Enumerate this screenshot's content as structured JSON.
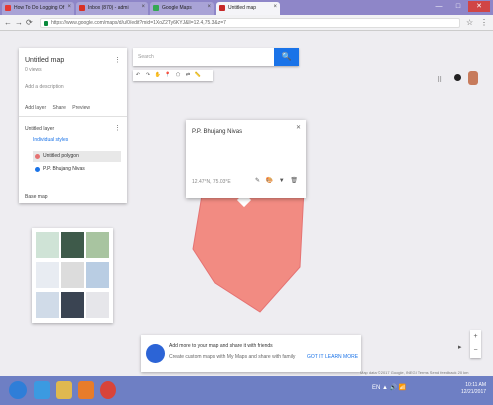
{
  "browser": {
    "tabs": [
      {
        "label": "How To Do Logging Of",
        "favicon_color": "#e53935",
        "active": false
      },
      {
        "label": "Inbox (870) - admi",
        "favicon_color": "#d93025",
        "active": false
      },
      {
        "label": "Google Maps",
        "favicon_color": "#34a853",
        "active": false
      },
      {
        "label": "Untitled map",
        "favicon_color": "#c62828",
        "active": true
      }
    ],
    "window_controls": {
      "minimize": "—",
      "maximize": "□",
      "close": "✕"
    },
    "url": "https://www.google.com/maps/d/u/0/edit?mid=1XoZ2Ty6KYJ&ll=12.4,75.3&z=7",
    "nav": {
      "back": "←",
      "forward": "→",
      "reload": "⟳",
      "star": "☆",
      "menu": "⋮"
    }
  },
  "map_panel": {
    "title": "Untitled map",
    "subtitle": "0 views",
    "description": "Add a description",
    "actions": [
      "Add layer",
      "Share",
      "Preview"
    ],
    "menu_glyph": "⋮",
    "layer_name": "Untitled layer",
    "layer_style": "Individual styles",
    "features": [
      {
        "label": "Untitled polygon",
        "color": "#e57373",
        "selected": true
      },
      {
        "label": "P.P. Bhujang Nivas",
        "color": "#1a73e8",
        "selected": false
      }
    ],
    "basemap_label": "Base map"
  },
  "basemap_thumbs": [
    {
      "name": "map",
      "color": "#cfe3d6"
    },
    {
      "name": "satellite",
      "color": "#3e5a4a"
    },
    {
      "name": "terrain",
      "color": "#a8c4a0"
    },
    {
      "name": "light-political",
      "color": "#e8ecf2"
    },
    {
      "name": "mono-city",
      "color": "#dcdcdc"
    },
    {
      "name": "simple-atlas",
      "color": "#b9cde3"
    },
    {
      "name": "light-landmass",
      "color": "#d0dbe8"
    },
    {
      "name": "dark-landmass",
      "color": "#3a4452"
    },
    {
      "name": "whitewater",
      "color": "#e6e6ea"
    }
  ],
  "search": {
    "placeholder": "Search",
    "button_icon": "🔍"
  },
  "tools": [
    "↶",
    "↷",
    "✋",
    "📍",
    "⬠",
    "⇄",
    "📏"
  ],
  "popup": {
    "title": "P.P. Bhujang Nivas",
    "close": "✕",
    "info": "12.47°N, 75.03°E",
    "icons": "✎ 🎨 ▼ 🗑"
  },
  "polygon": {
    "fill": "#f28b82",
    "stroke": "#e57373"
  },
  "marker": {
    "color": "#1a73e8"
  },
  "notice": {
    "title": "Add more to your map and share it with friends",
    "body": "Create custom maps with My Maps and share with family",
    "dismiss": "GOT IT",
    "learn_more": "LEARN MORE"
  },
  "zoom": {
    "plus": "+",
    "minus": "−"
  },
  "footer": "Map data ©2017 Google, INEGI  Terms  Send feedback  20 km",
  "taskbar": {
    "apps": [
      {
        "name": "start",
        "color": "#2f7ed8"
      },
      {
        "name": "internet-explorer",
        "color": "#3b9ae1"
      },
      {
        "name": "file-explorer",
        "color": "#e0b850"
      },
      {
        "name": "media-player",
        "color": "#e77c2b"
      },
      {
        "name": "chrome",
        "color": "#d9443a"
      }
    ],
    "tray": "EN ▲ 🔊 📶",
    "time": "10:11 AM",
    "date": "12/21/2017"
  }
}
